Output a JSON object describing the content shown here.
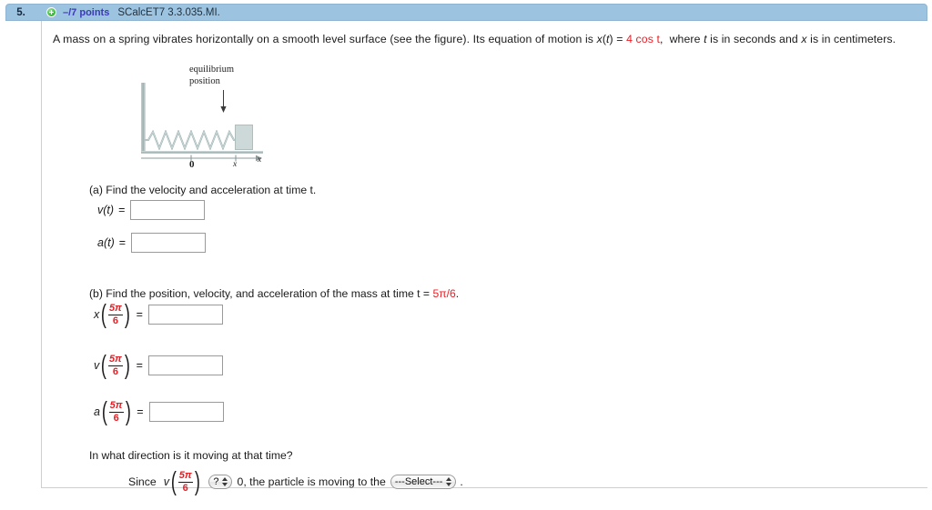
{
  "header": {
    "question_number": "5.",
    "plus_icon": "plus-circle-icon",
    "points": "–/7 points",
    "problem_code": "SCalcET7 3.3.035.MI."
  },
  "stem": {
    "text_before": "A mass on a spring vibrates horizontally on a smooth level surface (see the figure). Its equation of motion is ",
    "equation_lhs": "x",
    "equation_var": "(t)",
    "equals": " = ",
    "equation_rhs": "4 cos t",
    "text_after": ",  where t is in seconds and x is in centimeters."
  },
  "figure": {
    "name": "mass-spring-diagram",
    "equilibrium_label_line1": "equilibrium",
    "equilibrium_label_line2": "position",
    "tick_zero": "0",
    "tick_x": "x",
    "axis_label": "x"
  },
  "part_a": {
    "prompt": "(a) Find the velocity and acceleration at time t.",
    "rows": [
      {
        "label": "v(t)",
        "equals": "=",
        "value": "",
        "placeholder": ""
      },
      {
        "label": "a(t)",
        "equals": "=",
        "value": "",
        "placeholder": ""
      }
    ]
  },
  "part_b": {
    "prompt_before": "(b) Find the position, velocity, and acceleration of the mass at time t = ",
    "prompt_time": "5π/6",
    "prompt_after": ".",
    "fraction": {
      "numerator": "5π",
      "denominator": "6"
    },
    "rows": [
      {
        "func": "x",
        "equals": "=",
        "value": "",
        "placeholder": ""
      },
      {
        "func": "v",
        "equals": "=",
        "value": "",
        "placeholder": ""
      },
      {
        "func": "a",
        "equals": "=",
        "value": "",
        "placeholder": ""
      }
    ]
  },
  "direction": {
    "prompt": "In what direction is it moving at that time?",
    "since_word": "Since",
    "func": "v",
    "compare_select_value": "?",
    "middle_text": "0, the particle is moving to the",
    "direction_select_value": "---Select---",
    "trailing_period": "."
  },
  "colors": {
    "header_bar": "#9cc3e0",
    "points_text": "#3b3bb5",
    "highlight_red": "#e81e25",
    "rule": "#cfcfcf"
  }
}
